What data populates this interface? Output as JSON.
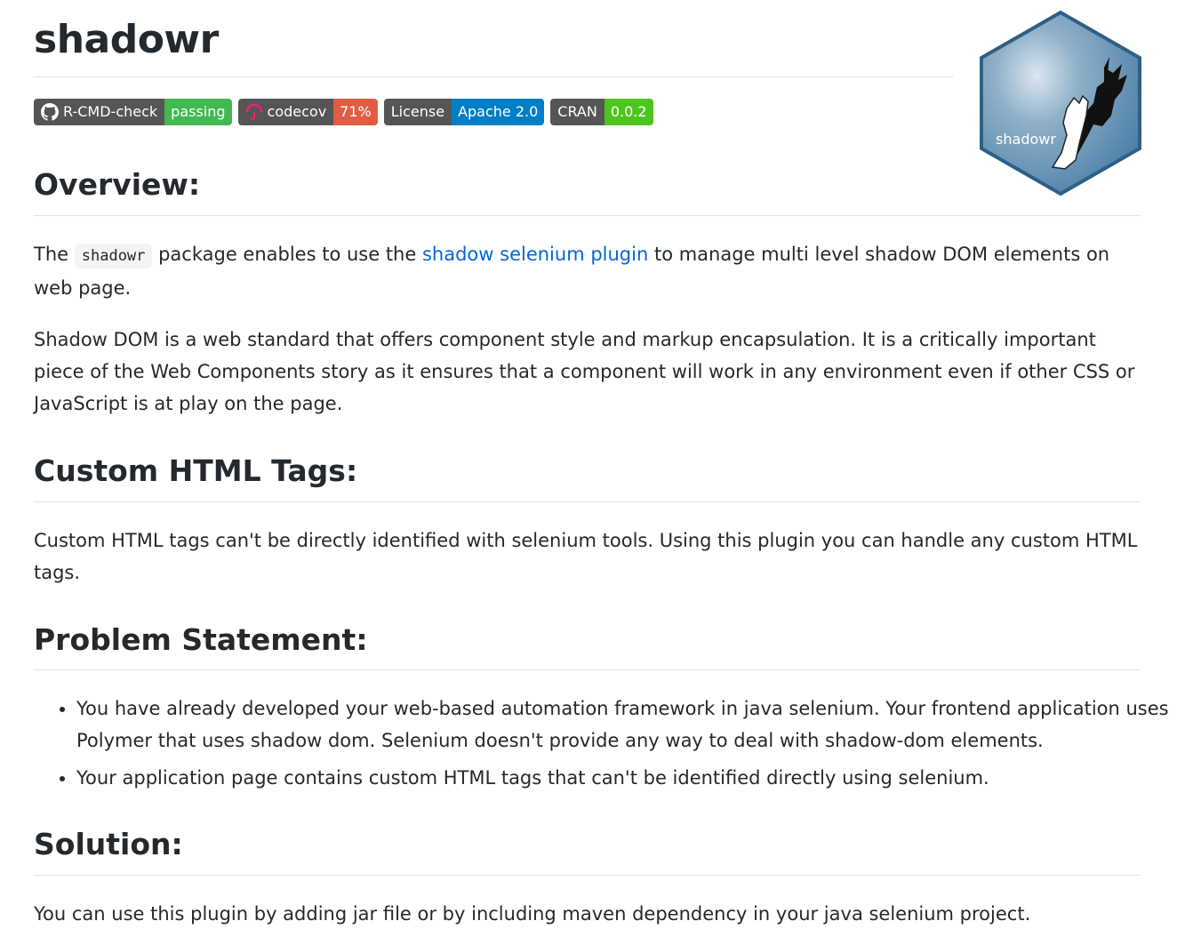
{
  "title": "shadowr",
  "badges": [
    {
      "label": "R-CMD-check",
      "value": "passing",
      "value_color": "#4c1"
    },
    {
      "label": "codecov",
      "value": "71%",
      "value_color": "#e05d44"
    },
    {
      "label": "License",
      "value": "Apache 2.0",
      "value_color": "#007ec6"
    },
    {
      "label": "CRAN",
      "value": "0.0.2",
      "value_color": "#4c1"
    }
  ],
  "logo": {
    "text": "shadowr",
    "color": "#4a7fa7"
  },
  "overview": {
    "heading": "Overview:",
    "p1_prefix": "The",
    "p1_code": "shadowr",
    "p1_middle": "package enables to use the",
    "p1_link": "shadow selenium plugin",
    "p1_suffix": "to manage multi level shadow DOM elements on web page.",
    "p2": "Shadow DOM is a web standard that offers component style and markup encapsulation. It is a critically important piece of the Web Components story as it ensures that a component will work in any environment even if other CSS or JavaScript is at play on the page."
  },
  "custom_tags": {
    "heading": "Custom HTML Tags:",
    "p": "Custom HTML tags can't be directly identified with selenium tools. Using this plugin you can handle any custom HTML tags."
  },
  "problem": {
    "heading": "Problem Statement:",
    "items": [
      "You have already developed your web-based automation framework in java selenium. Your frontend application uses Polymer that uses shadow dom. Selenium doesn't provide any way to deal with shadow-dom elements.",
      "Your application page contains custom HTML tags that can't be identified directly using selenium."
    ]
  },
  "solution": {
    "heading": "Solution:",
    "p": "You can use this plugin by adding jar file or by including maven dependency in your java selenium project."
  }
}
